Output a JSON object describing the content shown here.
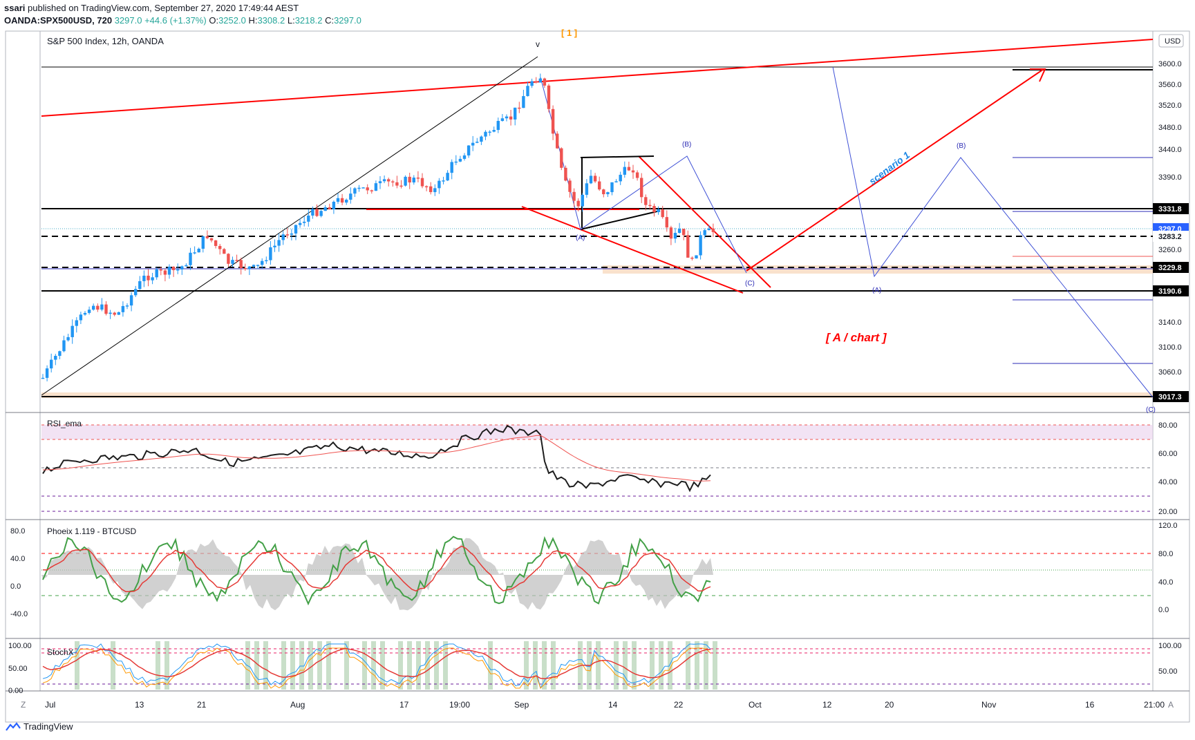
{
  "header": {
    "publisher": "ssari",
    "published_text": "published on TradingView.com, September 27, 2020 17:49:44 AEST",
    "symbol": "OANDA:SPX500USD, 720",
    "last": "3297.0",
    "change": "+44.6 (+1.37%)",
    "o_label": "O:",
    "o_val": "3252.0",
    "h_label": "H:",
    "h_val": "3308.2",
    "l_label": "L:",
    "l_val": "3218.2",
    "c_label": "C:",
    "c_val": "3297.0"
  },
  "chart": {
    "legend": "S&P 500 Index, 12h, OANDA",
    "currency": "USD",
    "price_ticks": [
      "3600.0",
      "3560.0",
      "3520.0",
      "3480.0",
      "3440.0",
      "3390.0",
      "3260.0",
      "3140.0",
      "3100.0",
      "3060.0"
    ],
    "price_labels": [
      {
        "text": "3331.8",
        "type": "black"
      },
      {
        "text": "3297.0",
        "type": "blue"
      },
      {
        "text": "3283.2",
        "type": "plain"
      },
      {
        "text": "3229.8",
        "type": "black"
      },
      {
        "text": "3190.6",
        "type": "black"
      },
      {
        "text": "3017.3",
        "type": "black"
      }
    ],
    "annotations": {
      "scenario": "scenario 1",
      "a_chart": "[ A / chart ]",
      "wave_v": "v",
      "wave_a": "(A)",
      "wave_b": "(B)",
      "wave_c": "(C)",
      "top_bracket": "[ 1 ]"
    },
    "x_ticks": [
      "Jul",
      "13",
      "21",
      "Aug",
      "17",
      "19:00",
      "Sep",
      "14",
      "22",
      "Oct",
      "12",
      "20",
      "Nov",
      "16",
      "21:00"
    ]
  },
  "rsi": {
    "title": "RSI_ema",
    "ticks": [
      "80.00",
      "60.00",
      "40.00",
      "20.00"
    ]
  },
  "phoenix": {
    "title": "Phoeix 1.119 - BTCUSD",
    "left_ticks": [
      "80.0",
      "40.0",
      "0.0",
      "-40.0"
    ],
    "right_ticks": [
      "120.0",
      "80.0",
      "40.0",
      "0.0"
    ]
  },
  "stoch": {
    "title": "StochX",
    "left_ticks": [
      "100.00",
      "50.00",
      "0.00"
    ],
    "right_ticks": [
      "100.00",
      "50.00"
    ]
  },
  "footer": {
    "brand": "TradingView"
  },
  "chart_data": {
    "type": "candlestick",
    "title": "S&P 500 Index, 12h, OANDA",
    "ohlc_last": {
      "open": 3252.0,
      "high": 3308.2,
      "low": 3218.2,
      "close": 3297.0
    },
    "horizontal_levels": [
      3331.8,
      3283.2,
      3229.8,
      3190.6,
      3017.3
    ],
    "ylim": [
      3000,
      3640
    ],
    "colors": {
      "up": "#2196f3",
      "down": "#ef5350",
      "trend": "#ff0000",
      "wave": "#3f51d6"
    }
  }
}
